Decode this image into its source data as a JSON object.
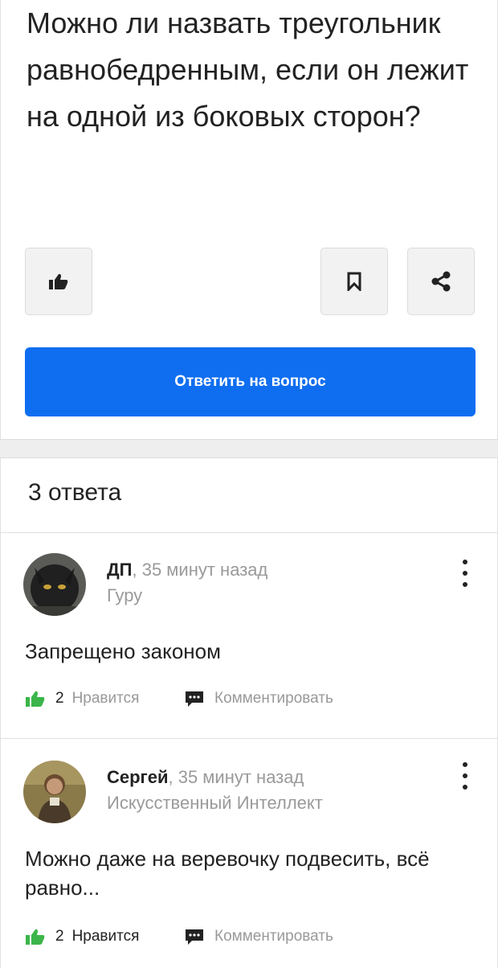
{
  "question": {
    "title": "Можно ли назвать треугольник равнобедренным, если он лежит на одной из боковых сторон?",
    "answer_button_label": "Ответить на вопрос"
  },
  "answers_section": {
    "count_label": "3 ответа",
    "answers": [
      {
        "author": "ДП",
        "time": ", 35 минут назад",
        "rank": "Гуру",
        "text": "Запрещено законом",
        "likes": "2",
        "like_label": "Нравится",
        "comment_label": "Комментировать"
      },
      {
        "author": "Сергей",
        "time": ", 35 минут назад",
        "rank": "Искусственный Интеллект",
        "text": "Можно даже на веревочку подвесить, всё равно...",
        "likes": "2",
        "like_label": "Нравится",
        "comment_label": "Комментировать"
      }
    ]
  },
  "colors": {
    "primary": "#0f6ef0",
    "like_green": "#3bb54a",
    "muted_text": "#999999"
  },
  "icons": [
    "thumbs-up-icon",
    "bookmark-icon",
    "share-icon",
    "more-vertical-icon",
    "comment-icon"
  ]
}
